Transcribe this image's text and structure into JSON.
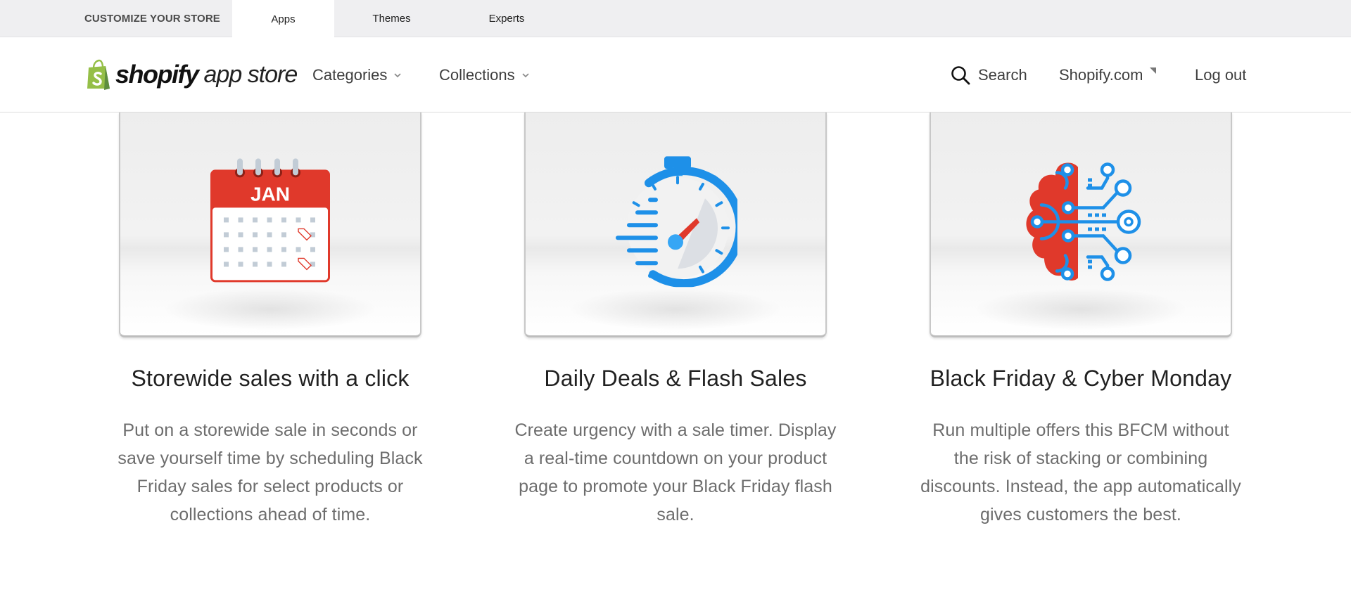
{
  "topbar": {
    "section_label": "CUSTOMIZE YOUR STORE",
    "tabs": [
      {
        "label": "Apps",
        "active": true
      },
      {
        "label": "Themes",
        "active": false
      },
      {
        "label": "Experts",
        "active": false
      }
    ]
  },
  "header": {
    "logo": {
      "brand": "shopify",
      "suffix": "app store",
      "icon": "shopify-bag-icon"
    },
    "nav": [
      {
        "label": "Categories",
        "icon": "chevron-down-icon"
      },
      {
        "label": "Collections",
        "icon": "chevron-down-icon"
      }
    ],
    "right": {
      "search_label": "Search",
      "search_icon": "search-icon",
      "shopify_link": "Shopify.com",
      "shopify_icon": "external-corner-icon",
      "logout_label": "Log out"
    }
  },
  "features": [
    {
      "illustration": "calendar-icon",
      "month": "JAN",
      "title": "Storewide sales with a click",
      "description": "Put on a storewide sale in seconds or save yourself time by scheduling Black Friday sales for select products or collections ahead of time."
    },
    {
      "illustration": "stopwatch-icon",
      "title": "Daily Deals & Flash Sales",
      "description": "Create urgency with a sale timer. Display a real-time countdown on your product page to promote your Black Friday flash sale."
    },
    {
      "illustration": "brain-circuit-icon",
      "title": "Black Friday & Cyber Monday",
      "description": "Run multiple offers this BFCM without the risk of stacking or combining discounts. Instead, the app automatically gives customers the best."
    }
  ],
  "colors": {
    "brand_green": "#95bf47",
    "accent_red": "#e0392b",
    "accent_blue": "#1e90e8",
    "topbar_bg": "#efeff1"
  }
}
